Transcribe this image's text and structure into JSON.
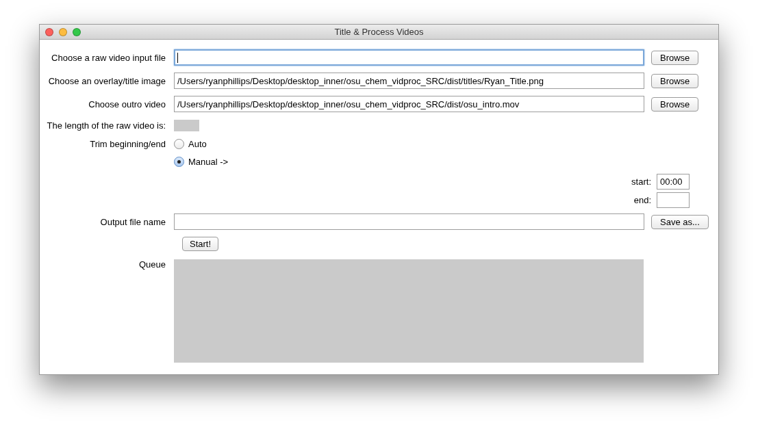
{
  "window": {
    "title": "Title & Process Videos"
  },
  "file_rows": [
    {
      "label": "Choose a raw video input file",
      "value": "",
      "focused": true,
      "button": "Browse"
    },
    {
      "label": "Choose an overlay/title image",
      "value": "/Users/ryanphillips/Desktop/desktop_inner/osu_chem_vidproc_SRC/dist/titles/Ryan_Title.png",
      "focused": false,
      "button": "Browse"
    },
    {
      "label": "Choose outro video",
      "value": "/Users/ryanphillips/Desktop/desktop_inner/osu_chem_vidproc_SRC/dist/osu_intro.mov",
      "focused": false,
      "button": "Browse"
    }
  ],
  "length": {
    "label": "The length of the raw video is:"
  },
  "trim": {
    "label": "Trim beginning/end",
    "options": [
      {
        "label": "Auto",
        "selected": false
      },
      {
        "label": "Manual ->",
        "selected": true
      }
    ],
    "start_label": "start:",
    "start_value": "00:00",
    "end_label": "end:"
  },
  "output": {
    "label": "Output file name",
    "button": "Save as..."
  },
  "start_button": "Start!",
  "queue": {
    "label": "Queue"
  }
}
